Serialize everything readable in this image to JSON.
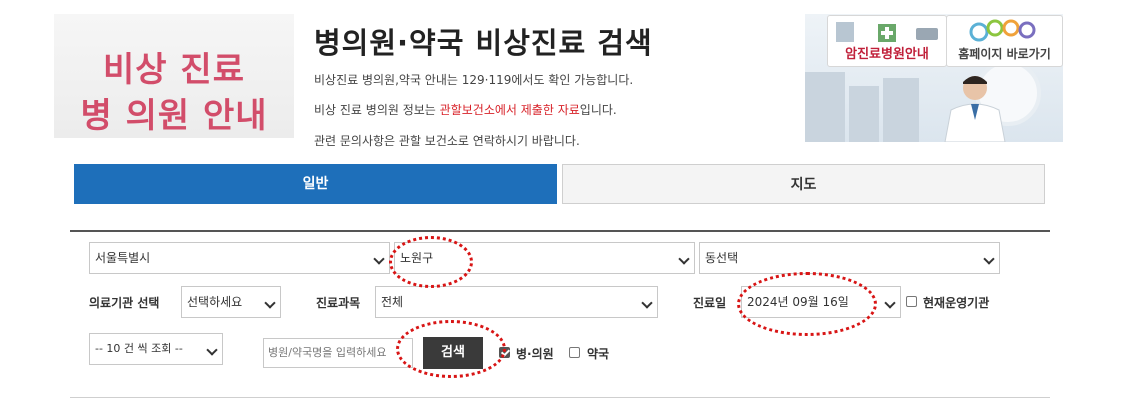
{
  "banner": {
    "left_line1": "비상 진료",
    "left_line2": "병 의원 안내",
    "title": "병의원·약국 비상진료 검색",
    "desc1": "비상진료 병의원,약국 안내는 129·119에서도 확인 가능합니다.",
    "desc2_pre": "비상 진료 병의원 정보는 ",
    "desc2_hl": "관할보건소에서 제출한 자료",
    "desc2_post": "입니다.",
    "desc3": "관련 문의사항은 관할 보건소로 연락하시기 바랍니다."
  },
  "ad": {
    "cancer_hospital": "암진료병원안내",
    "homepage": "홈페이지 바로가기"
  },
  "tabs": {
    "general": "일반",
    "map": "지도"
  },
  "filters": {
    "city": "서울특별시",
    "district": "노원구",
    "dong": "동선택",
    "institution_label": "의료기관 선택",
    "institution_value": "선택하세요",
    "department_label": "진료과목",
    "department_value": "전체",
    "date_label": "진료일",
    "date_value": "2024년 09월 16일",
    "operating_label": "현재운영기관",
    "page_size": "-- 10 건 씩 조회 --",
    "search_placeholder": "병원/약국명을 입력하세요",
    "search_button": "검색",
    "hospital_label": "병·의원",
    "pharmacy_label": "약국"
  },
  "state": {
    "hospital_checked": true,
    "pharmacy_checked": false,
    "operating_checked": false
  },
  "colors": {
    "accent_tab": "#1e6fba",
    "banner_pink": "#d24d6a",
    "highlight_red": "#d8232a",
    "annotation_red": "#d81515"
  }
}
